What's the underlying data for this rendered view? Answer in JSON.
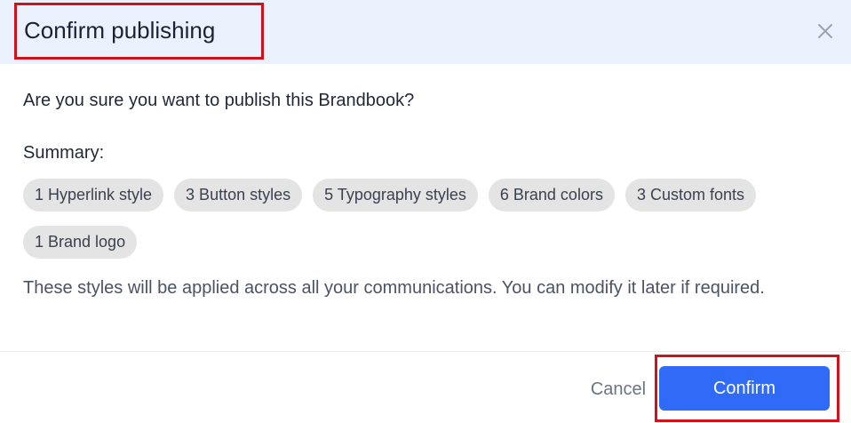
{
  "dialog": {
    "title": "Confirm publishing",
    "close_icon": "close-icon",
    "question": "Are you sure you want to publish this Brandbook?",
    "summary_label": "Summary:",
    "summary_items": [
      "1 Hyperlink style",
      "3 Button styles",
      "5 Typography styles",
      "6 Brand colors",
      "3 Custom fonts",
      "1 Brand logo"
    ],
    "note": "These styles will be applied across all your communications. You can modify it later if required.",
    "cancel_label": "Cancel",
    "confirm_label": "Confirm"
  },
  "colors": {
    "header_background": "#eaf3fd",
    "primary_button": "#2f6bf7",
    "chip_background": "#e4e4e5",
    "highlight_outline": "#d0131b"
  }
}
